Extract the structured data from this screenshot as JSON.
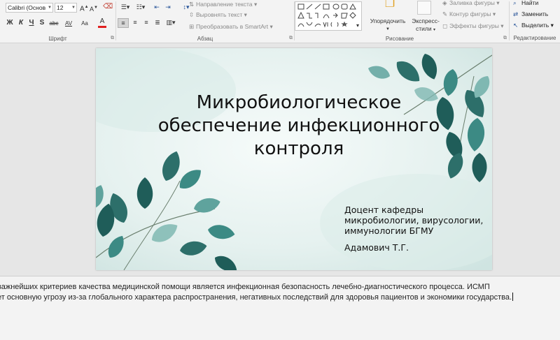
{
  "ribbon": {
    "font": {
      "name": "Calibri (Основ",
      "size": "12",
      "grow": "A",
      "shrink": "A",
      "bold": "Ж",
      "italic": "К",
      "underline": "Ч",
      "shadow": "S",
      "strike": "abc",
      "spacing": "AV",
      "case": "Aa",
      "color_letter": "A",
      "label": "Шрифт"
    },
    "paragraph": {
      "text_direction": "Направление текста",
      "align_text": "Выровнять текст",
      "convert_smartart": "Преобразовать в SmartArt",
      "label": "Абзац"
    },
    "drawing": {
      "arrange": "Упорядочить",
      "quick_styles": "Экспресс-стили",
      "quick_styles_line1": "Экспресс-",
      "quick_styles_line2": "стили",
      "shape_fill": "Заливка фигуры",
      "shape_outline": "Контур фигуры",
      "shape_effects": "Эффекты фигуры",
      "label": "Рисование"
    },
    "editing": {
      "find": "Найти",
      "replace": "Заменить",
      "select": "Выделить",
      "label": "Редактирование"
    }
  },
  "slide": {
    "title_lines": [
      "Микробиологическое",
      "обеспечение инфекционного",
      "контроля"
    ],
    "subtitle_lines": [
      "Доцент кафедры",
      "микробиологии, вирусологии,",
      "иммунологии БГМУ"
    ],
    "author": "Адамович Т.Г.",
    "colors": {
      "leaf_dark": "#1f5d59",
      "leaf_mid": "#3c8a84",
      "leaf_light": "#7fb8b2",
      "background": "#eef5f4"
    }
  },
  "notes": {
    "line1": "важнейших критериев качества медицинской помощи является инфекционная безопасность лечебно-диагностического процесса. ИСМП",
    "line2": "ет основную угрозу из-за глобального характера распространения, негативных последствий для здоровья пациентов и экономики государства."
  }
}
